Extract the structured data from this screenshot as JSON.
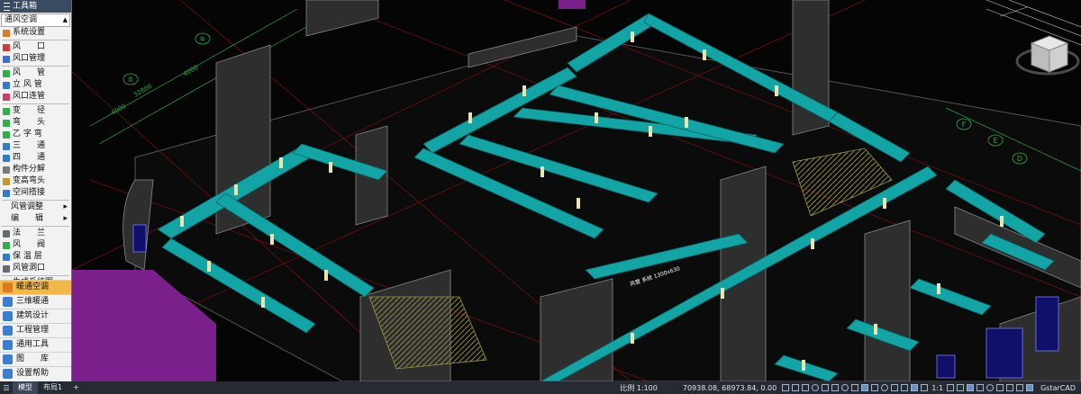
{
  "toolbox": {
    "title": "工具箱",
    "category": "通风空调",
    "items1": [
      {
        "label": "系统设置",
        "icon": "gear-icon",
        "color": "#e07a1f"
      }
    ],
    "items2": [
      {
        "label": "风　　口",
        "icon": "air-outlet-icon",
        "color": "#d23b3b"
      },
      {
        "label": "风口管理",
        "icon": "outlet-manager-icon",
        "color": "#3b6fd2"
      }
    ],
    "items3": [
      {
        "label": "风　　管",
        "icon": "duct-icon",
        "color": "#2fae4a"
      },
      {
        "label": "立 风 管",
        "icon": "vertical-duct-icon",
        "color": "#2f7bd2"
      },
      {
        "label": "风口连管",
        "icon": "outlet-connector-icon",
        "color": "#d23b6a"
      }
    ],
    "items4": [
      {
        "label": "变　　径",
        "icon": "reducer-icon",
        "color": "#2fae4a"
      },
      {
        "label": "弯　　头",
        "icon": "elbow-icon",
        "color": "#2fae4a"
      },
      {
        "label": "乙 字 弯",
        "icon": "offset-icon",
        "color": "#2fae4a"
      },
      {
        "label": "三　　通",
        "icon": "tee-icon",
        "color": "#2f7bd2"
      },
      {
        "label": "四　　通",
        "icon": "cross-icon",
        "color": "#2f7bd2"
      },
      {
        "label": "构件分解",
        "icon": "decompose-icon",
        "color": "#7a7a7a"
      },
      {
        "label": "变高弯头",
        "icon": "height-elbow-icon",
        "color": "#c29a2a"
      },
      {
        "label": "空间搭接",
        "icon": "space-joint-icon",
        "color": "#2f7bd2"
      }
    ],
    "submenus": [
      {
        "label": "风管调整"
      },
      {
        "label": "编　　辑"
      }
    ],
    "items5": [
      {
        "label": "法　　兰",
        "icon": "flange-icon",
        "color": "#6a6a6a"
      },
      {
        "label": "风　　阀",
        "icon": "damper-icon",
        "color": "#2fae4a"
      },
      {
        "label": "保 温 层",
        "icon": "insulation-icon",
        "color": "#2f7bd2"
      },
      {
        "label": "风管洞口",
        "icon": "duct-opening-icon",
        "color": "#6a6a6a"
      }
    ],
    "items6": [
      {
        "label": "生成系统图",
        "icon": "system-diagram-icon",
        "color": "#6a6a6a"
      }
    ],
    "bottom": [
      {
        "label": "暖通空调",
        "icon": "hvac-icon",
        "color": "#d97b1f",
        "active": true
      },
      {
        "label": "三维暖通",
        "icon": "3d-hvac-icon",
        "color": "#3b7fd2",
        "active": false
      },
      {
        "label": "建筑设计",
        "icon": "architecture-icon",
        "color": "#3b7fd2",
        "active": false
      },
      {
        "label": "工程管理",
        "icon": "project-icon",
        "color": "#3b7fd2",
        "active": false
      },
      {
        "label": "通用工具",
        "icon": "tools-icon",
        "color": "#3b7fd2",
        "active": false
      },
      {
        "label": "图　　库",
        "icon": "library-icon",
        "color": "#3b7fd2",
        "active": false
      },
      {
        "label": "设置帮助",
        "icon": "help-icon",
        "color": "#3b7fd2",
        "active": false
      }
    ]
  },
  "drawing": {
    "grid_labels": [
      "⑤",
      "⑥",
      "F",
      "E",
      "D"
    ],
    "dimensions": [
      "4000",
      "32800",
      "4000"
    ],
    "annotation": "风管 系统 1300x630",
    "colors": {
      "duct": "#13a5a5",
      "duct_top": "#27c7c2",
      "flange": "#e9e4b0",
      "wall": "#3a3a3a",
      "stair": "#6b6b24",
      "purple": "#7a1f8c"
    }
  },
  "statusbar": {
    "tabs": [
      "模型",
      "布局1"
    ],
    "add_tab": "+",
    "scale": "比例 1:100",
    "coords": "70938.08, 68973.84, 0.00",
    "zoom": "1:1",
    "app": "GstarCAD"
  }
}
